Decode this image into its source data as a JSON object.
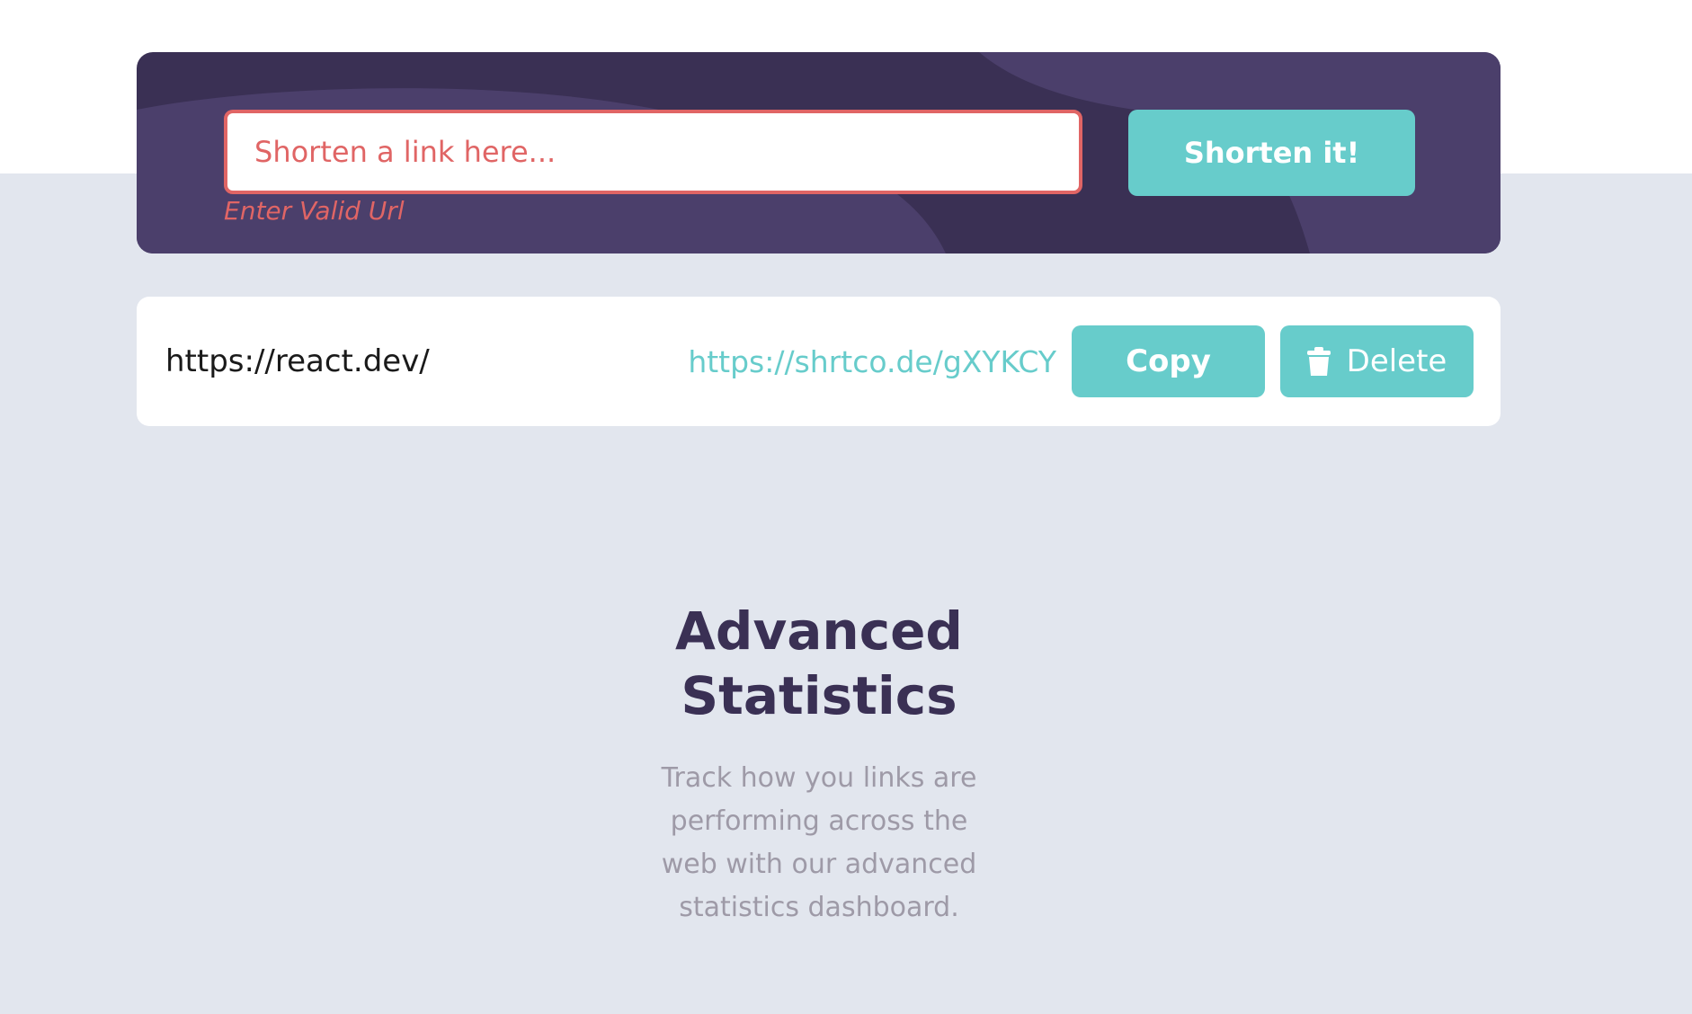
{
  "shortener": {
    "input_placeholder": "Shorten a link here...",
    "error_message": "Enter Valid Url",
    "submit_label": "Shorten it!"
  },
  "results": [
    {
      "original_url": "https://react.dev/",
      "short_url": "https://shrtco.de/gXYKCY",
      "copy_label": "Copy",
      "delete_label": "Delete",
      "delete_icon": "trash-icon"
    }
  ],
  "stats_section": {
    "title_line1": "Advanced",
    "title_line2": "Statistics",
    "description": "Track how you links are performing across the web with our advanced statistics dashboard."
  },
  "colors": {
    "primary_cyan": "#67cccb",
    "dark_violet": "#3a3054",
    "panel_shape": "#4b3f6b",
    "error_red": "#e06565",
    "background_gray": "#e2e6ee",
    "text_gray": "#9e9aa7"
  }
}
